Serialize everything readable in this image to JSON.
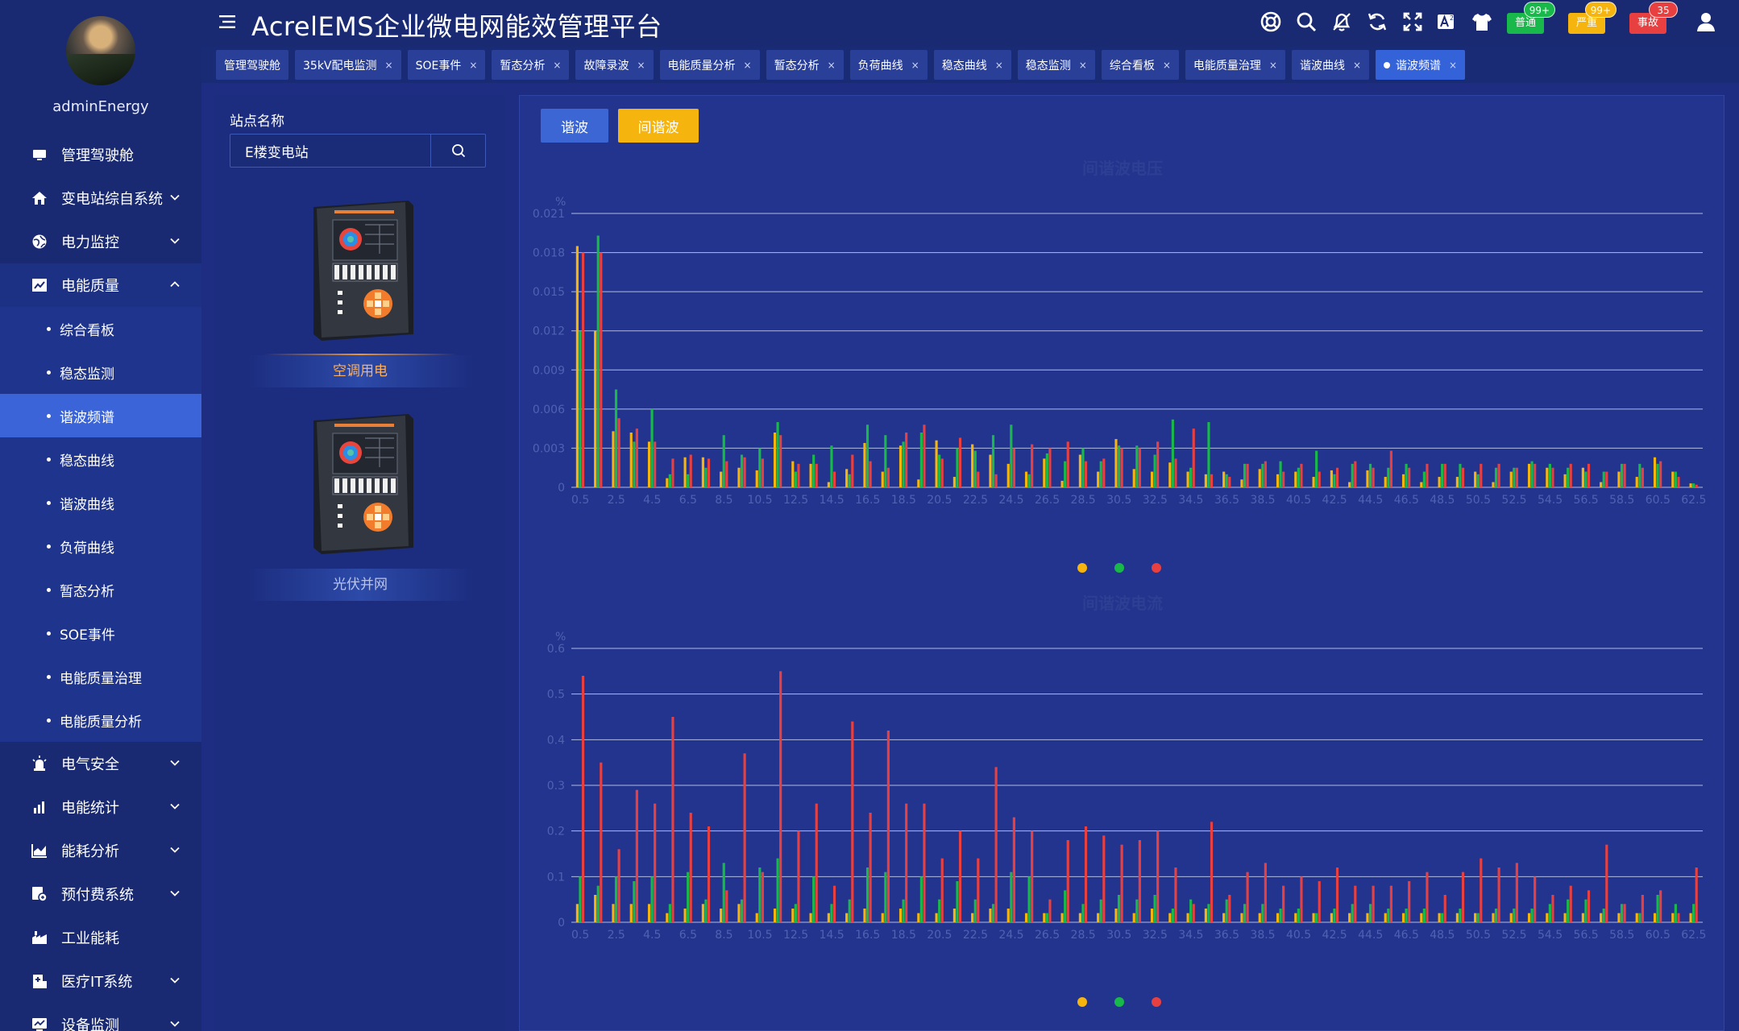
{
  "app": {
    "title": "AcrelEMS企业微电网能效管理平台"
  },
  "user": {
    "name": "adminEnergy"
  },
  "header": {
    "alarms": [
      {
        "label": "普通",
        "count": "99+",
        "color": "#19b84a"
      },
      {
        "label": "严重",
        "count": "99+",
        "color": "#f6b40e"
      },
      {
        "label": "事故",
        "count": "35",
        "color": "#e84040"
      }
    ]
  },
  "sidebar": {
    "items": [
      {
        "label": "管理驾驶舱",
        "icon": "monitor-icon",
        "chevron": false
      },
      {
        "label": "变电站综自系统",
        "icon": "home-icon",
        "chevron": true
      },
      {
        "label": "电力监控",
        "icon": "globe-icon",
        "chevron": true
      },
      {
        "label": "电能质量",
        "icon": "chart-icon",
        "chevron": true,
        "open": true,
        "sub": [
          "综合看板",
          "稳态监测",
          "谐波频谱",
          "稳态曲线",
          "谐波曲线",
          "负荷曲线",
          "暂态分析",
          "SOE事件",
          "电能质量治理",
          "电能质量分析"
        ],
        "active_sub": 2
      },
      {
        "label": "电气安全",
        "icon": "alarm-light-icon",
        "chevron": true
      },
      {
        "label": "电能统计",
        "icon": "bar-chart-icon",
        "chevron": true
      },
      {
        "label": "能耗分析",
        "icon": "area-chart-icon",
        "chevron": true
      },
      {
        "label": "预付费系统",
        "icon": "prepaid-icon",
        "chevron": true
      },
      {
        "label": "工业能耗",
        "icon": "factory-icon",
        "chevron": false
      },
      {
        "label": "医疗IT系统",
        "icon": "hospital-icon",
        "chevron": true
      },
      {
        "label": "设备监测",
        "icon": "device-icon",
        "chevron": true
      }
    ]
  },
  "tabs": [
    {
      "label": "管理驾驶舱",
      "closable": false
    },
    {
      "label": "35kV配电监测",
      "closable": true
    },
    {
      "label": "SOE事件",
      "closable": true
    },
    {
      "label": "暂态分析",
      "closable": true
    },
    {
      "label": "故障录波",
      "closable": true
    },
    {
      "label": "电能质量分析",
      "closable": true
    },
    {
      "label": "暂态分析",
      "closable": true
    },
    {
      "label": "负荷曲线",
      "closable": true
    },
    {
      "label": "稳态曲线",
      "closable": true
    },
    {
      "label": "稳态监测",
      "closable": true
    },
    {
      "label": "综合看板",
      "closable": true
    },
    {
      "label": "电能质量治理",
      "closable": true
    },
    {
      "label": "谐波曲线",
      "closable": true
    },
    {
      "label": "谐波频谱",
      "closable": true,
      "active": true
    }
  ],
  "station": {
    "label": "站点名称",
    "value": "E楼变电站",
    "devices": [
      {
        "name": "空调用电",
        "selected": true
      },
      {
        "name": "光伏并网",
        "selected": false
      }
    ]
  },
  "main": {
    "btn_harmonic": "谐波",
    "btn_interharmonic": "间谐波"
  },
  "colors": {
    "phaseA": "#f6b40e",
    "phaseB": "#19b84a",
    "phaseC": "#e84040"
  },
  "chart_data": [
    {
      "type": "bar",
      "title": "间谐波电压",
      "ylabel": "%",
      "ylim": [
        0,
        0.021
      ],
      "yticks": [
        "0",
        "0.003",
        "0.006",
        "0.009",
        "0.012",
        "0.015",
        "0.018",
        "0.021"
      ],
      "xlabel_ticks": [
        "0.5",
        "2.5",
        "4.5",
        "6.5",
        "8.5",
        "10.5",
        "12.5",
        "14.5",
        "16.5",
        "18.5",
        "20.5",
        "22.5",
        "24.5",
        "26.5",
        "28.5",
        "30.5",
        "32.5",
        "34.5",
        "36.5",
        "38.5",
        "40.5",
        "42.5",
        "44.5",
        "46.5",
        "48.5",
        "50.5",
        "52.5",
        "54.5",
        "56.5",
        "58.5",
        "60.5",
        "62.5"
      ],
      "legend": [
        "",
        "",
        ""
      ],
      "categories": [
        "0.5",
        "1.5",
        "2.5",
        "3.5",
        "4.5",
        "5.5",
        "6.5",
        "7.5",
        "8.5",
        "9.5",
        "10.5",
        "11.5",
        "12.5",
        "13.5",
        "14.5",
        "15.5",
        "16.5",
        "17.5",
        "18.5",
        "19.5",
        "20.5",
        "21.5",
        "22.5",
        "23.5",
        "24.5",
        "25.5",
        "26.5",
        "27.5",
        "28.5",
        "29.5",
        "30.5",
        "31.5",
        "32.5",
        "33.5",
        "34.5",
        "35.5",
        "36.5",
        "37.5",
        "38.5",
        "39.5",
        "40.5",
        "41.5",
        "42.5",
        "43.5",
        "44.5",
        "45.5",
        "46.5",
        "47.5",
        "48.5",
        "49.5",
        "50.5",
        "51.5",
        "52.5",
        "53.5",
        "54.5",
        "55.5",
        "56.5",
        "57.5",
        "58.5",
        "59.5",
        "60.5",
        "61.5",
        "62.5"
      ],
      "series": [
        {
          "values": [
            0.0185,
            0.012,
            0.0043,
            0.0042,
            0.0035,
            0.0007,
            0.0023,
            0.0023,
            0.0012,
            0.0015,
            0.0013,
            0.0042,
            0.002,
            0.0018,
            0.0004,
            0.0014,
            0.0034,
            0.0012,
            0.0032,
            0.0006,
            0.0036,
            0.0008,
            0.0033,
            0.0025,
            0.0018,
            0.0012,
            0.0022,
            0.0005,
            0.0025,
            0.0012,
            0.0037,
            0.0014,
            0.0012,
            0.0019,
            0.0012,
            0.001,
            0.0012,
            0.0006,
            0.0014,
            0.001,
            0.0012,
            0.0008,
            0.0013,
            0.0004,
            0.0013,
            0.0008,
            0.001,
            0.0004,
            0.0008,
            0.0008,
            0.0012,
            0.0004,
            0.0012,
            0.0018,
            0.0015,
            0.001,
            0.0015,
            0.0004,
            0.0012,
            0.0008,
            0.0023,
            0.0012,
            0.0003
          ]
        },
        {
          "values": [
            0.012,
            0.0193,
            0.0075,
            0.0035,
            0.006,
            0.001,
            0.001,
            0.0015,
            0.004,
            0.0025,
            0.003,
            0.005,
            0.0012,
            0.0025,
            0.0032,
            0.001,
            0.0048,
            0.004,
            0.0035,
            0.0042,
            0.0025,
            0.003,
            0.0028,
            0.004,
            0.0048,
            0.001,
            0.0026,
            0.002,
            0.003,
            0.002,
            0.0032,
            0.0032,
            0.0025,
            0.0052,
            0.0015,
            0.005,
            0.001,
            0.0018,
            0.0018,
            0.002,
            0.0015,
            0.0028,
            0.001,
            0.0018,
            0.0018,
            0.0015,
            0.0018,
            0.0012,
            0.0018,
            0.0018,
            0.001,
            0.0015,
            0.0015,
            0.002,
            0.0018,
            0.0015,
            0.0012,
            0.0012,
            0.0018,
            0.0018,
            0.0018,
            0.0012,
            0.0003
          ]
        },
        {
          "values": [
            0.018,
            0.018,
            0.0053,
            0.0045,
            0.0035,
            0.0022,
            0.0025,
            0.0022,
            0.002,
            0.0023,
            0.0022,
            0.004,
            0.0018,
            0.0018,
            0.0012,
            0.0025,
            0.002,
            0.0015,
            0.0042,
            0.0048,
            0.0022,
            0.0038,
            0.0012,
            0.001,
            0.003,
            0.0033,
            0.003,
            0.0035,
            0.002,
            0.0022,
            0.003,
            0.003,
            0.0035,
            0.0022,
            0.0045,
            0.001,
            0.0008,
            0.0018,
            0.002,
            0.0012,
            0.0018,
            0.0012,
            0.0015,
            0.002,
            0.0015,
            0.0028,
            0.0015,
            0.0018,
            0.0018,
            0.0015,
            0.0018,
            0.0018,
            0.0015,
            0.0018,
            0.0015,
            0.0018,
            0.0018,
            0.0012,
            0.0018,
            0.0015,
            0.002,
            0.0008,
            0.0002
          ]
        }
      ]
    },
    {
      "type": "bar",
      "title": "间谐波电流",
      "ylabel": "%",
      "ylim": [
        0,
        0.6
      ],
      "yticks": [
        "0",
        "0.1",
        "0.2",
        "0.3",
        "0.4",
        "0.5",
        "0.6"
      ],
      "xlabel_ticks": [
        "0.5",
        "2.5",
        "4.5",
        "6.5",
        "8.5",
        "10.5",
        "12.5",
        "14.5",
        "16.5",
        "18.5",
        "20.5",
        "22.5",
        "24.5",
        "26.5",
        "28.5",
        "30.5",
        "32.5",
        "34.5",
        "36.5",
        "38.5",
        "40.5",
        "42.5",
        "44.5",
        "46.5",
        "48.5",
        "50.5",
        "52.5",
        "54.5",
        "56.5",
        "58.5",
        "60.5",
        "62.5"
      ],
      "legend": [
        "",
        "",
        ""
      ],
      "categories": [
        "0.5",
        "1.5",
        "2.5",
        "3.5",
        "4.5",
        "5.5",
        "6.5",
        "7.5",
        "8.5",
        "9.5",
        "10.5",
        "11.5",
        "12.5",
        "13.5",
        "14.5",
        "15.5",
        "16.5",
        "17.5",
        "18.5",
        "19.5",
        "20.5",
        "21.5",
        "22.5",
        "23.5",
        "24.5",
        "25.5",
        "26.5",
        "27.5",
        "28.5",
        "29.5",
        "30.5",
        "31.5",
        "32.5",
        "33.5",
        "34.5",
        "35.5",
        "36.5",
        "37.5",
        "38.5",
        "39.5",
        "40.5",
        "41.5",
        "42.5",
        "43.5",
        "44.5",
        "45.5",
        "46.5",
        "47.5",
        "48.5",
        "49.5",
        "50.5",
        "51.5",
        "52.5",
        "53.5",
        "54.5",
        "55.5",
        "56.5",
        "57.5",
        "58.5",
        "59.5",
        "60.5",
        "61.5",
        "62.5"
      ],
      "series": [
        {
          "values": [
            0.04,
            0.06,
            0.04,
            0.04,
            0.04,
            0.02,
            0.03,
            0.04,
            0.03,
            0.04,
            0.02,
            0.03,
            0.03,
            0.02,
            0.02,
            0.02,
            0.03,
            0.02,
            0.03,
            0.02,
            0.02,
            0.03,
            0.02,
            0.03,
            0.03,
            0.02,
            0.02,
            0.02,
            0.02,
            0.02,
            0.03,
            0.02,
            0.03,
            0.02,
            0.02,
            0.03,
            0.02,
            0.02,
            0.02,
            0.02,
            0.02,
            0.02,
            0.02,
            0.02,
            0.02,
            0.02,
            0.02,
            0.02,
            0.02,
            0.02,
            0.02,
            0.02,
            0.02,
            0.02,
            0.02,
            0.02,
            0.02,
            0.02,
            0.02,
            0.02,
            0.02,
            0.02,
            0.02
          ]
        },
        {
          "values": [
            0.1,
            0.08,
            0.1,
            0.09,
            0.1,
            0.04,
            0.11,
            0.05,
            0.13,
            0.05,
            0.12,
            0.14,
            0.04,
            0.1,
            0.04,
            0.05,
            0.12,
            0.11,
            0.05,
            0.1,
            0.05,
            0.09,
            0.05,
            0.04,
            0.11,
            0.1,
            0.02,
            0.07,
            0.04,
            0.05,
            0.06,
            0.05,
            0.06,
            0.03,
            0.05,
            0.04,
            0.05,
            0.04,
            0.04,
            0.03,
            0.03,
            0.02,
            0.03,
            0.04,
            0.04,
            0.03,
            0.03,
            0.03,
            0.02,
            0.03,
            0.02,
            0.03,
            0.03,
            0.03,
            0.04,
            0.05,
            0.05,
            0.03,
            0.04,
            0.02,
            0.06,
            0.04,
            0.04
          ]
        },
        {
          "values": [
            0.54,
            0.35,
            0.16,
            0.29,
            0.26,
            0.45,
            0.24,
            0.21,
            0.07,
            0.37,
            0.11,
            0.55,
            0.2,
            0.26,
            0.08,
            0.44,
            0.24,
            0.42,
            0.26,
            0.26,
            0.14,
            0.2,
            0.14,
            0.34,
            0.23,
            0.2,
            0.05,
            0.18,
            0.21,
            0.19,
            0.17,
            0.18,
            0.2,
            0.12,
            0.04,
            0.22,
            0.06,
            0.11,
            0.13,
            0.08,
            0.1,
            0.09,
            0.12,
            0.08,
            0.08,
            0.08,
            0.09,
            0.11,
            0.06,
            0.11,
            0.14,
            0.12,
            0.13,
            0.1,
            0.06,
            0.08,
            0.07,
            0.17,
            0.04,
            0.06,
            0.07,
            0.02,
            0.12
          ]
        }
      ]
    }
  ]
}
